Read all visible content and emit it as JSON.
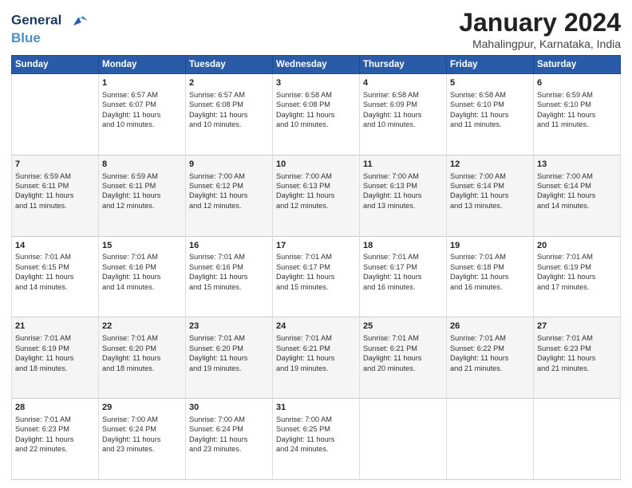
{
  "logo": {
    "line1": "General",
    "line2": "Blue"
  },
  "title": "January 2024",
  "location": "Mahalingpur, Karnataka, India",
  "header_days": [
    "Sunday",
    "Monday",
    "Tuesday",
    "Wednesday",
    "Thursday",
    "Friday",
    "Saturday"
  ],
  "weeks": [
    [
      {
        "day": "",
        "info": ""
      },
      {
        "day": "1",
        "info": "Sunrise: 6:57 AM\nSunset: 6:07 PM\nDaylight: 11 hours\nand 10 minutes."
      },
      {
        "day": "2",
        "info": "Sunrise: 6:57 AM\nSunset: 6:08 PM\nDaylight: 11 hours\nand 10 minutes."
      },
      {
        "day": "3",
        "info": "Sunrise: 6:58 AM\nSunset: 6:08 PM\nDaylight: 11 hours\nand 10 minutes."
      },
      {
        "day": "4",
        "info": "Sunrise: 6:58 AM\nSunset: 6:09 PM\nDaylight: 11 hours\nand 10 minutes."
      },
      {
        "day": "5",
        "info": "Sunrise: 6:58 AM\nSunset: 6:10 PM\nDaylight: 11 hours\nand 11 minutes."
      },
      {
        "day": "6",
        "info": "Sunrise: 6:59 AM\nSunset: 6:10 PM\nDaylight: 11 hours\nand 11 minutes."
      }
    ],
    [
      {
        "day": "7",
        "info": "Sunrise: 6:59 AM\nSunset: 6:11 PM\nDaylight: 11 hours\nand 11 minutes."
      },
      {
        "day": "8",
        "info": "Sunrise: 6:59 AM\nSunset: 6:11 PM\nDaylight: 11 hours\nand 12 minutes."
      },
      {
        "day": "9",
        "info": "Sunrise: 7:00 AM\nSunset: 6:12 PM\nDaylight: 11 hours\nand 12 minutes."
      },
      {
        "day": "10",
        "info": "Sunrise: 7:00 AM\nSunset: 6:13 PM\nDaylight: 11 hours\nand 12 minutes."
      },
      {
        "day": "11",
        "info": "Sunrise: 7:00 AM\nSunset: 6:13 PM\nDaylight: 11 hours\nand 13 minutes."
      },
      {
        "day": "12",
        "info": "Sunrise: 7:00 AM\nSunset: 6:14 PM\nDaylight: 11 hours\nand 13 minutes."
      },
      {
        "day": "13",
        "info": "Sunrise: 7:00 AM\nSunset: 6:14 PM\nDaylight: 11 hours\nand 14 minutes."
      }
    ],
    [
      {
        "day": "14",
        "info": "Sunrise: 7:01 AM\nSunset: 6:15 PM\nDaylight: 11 hours\nand 14 minutes."
      },
      {
        "day": "15",
        "info": "Sunrise: 7:01 AM\nSunset: 6:16 PM\nDaylight: 11 hours\nand 14 minutes."
      },
      {
        "day": "16",
        "info": "Sunrise: 7:01 AM\nSunset: 6:16 PM\nDaylight: 11 hours\nand 15 minutes."
      },
      {
        "day": "17",
        "info": "Sunrise: 7:01 AM\nSunset: 6:17 PM\nDaylight: 11 hours\nand 15 minutes."
      },
      {
        "day": "18",
        "info": "Sunrise: 7:01 AM\nSunset: 6:17 PM\nDaylight: 11 hours\nand 16 minutes."
      },
      {
        "day": "19",
        "info": "Sunrise: 7:01 AM\nSunset: 6:18 PM\nDaylight: 11 hours\nand 16 minutes."
      },
      {
        "day": "20",
        "info": "Sunrise: 7:01 AM\nSunset: 6:19 PM\nDaylight: 11 hours\nand 17 minutes."
      }
    ],
    [
      {
        "day": "21",
        "info": "Sunrise: 7:01 AM\nSunset: 6:19 PM\nDaylight: 11 hours\nand 18 minutes."
      },
      {
        "day": "22",
        "info": "Sunrise: 7:01 AM\nSunset: 6:20 PM\nDaylight: 11 hours\nand 18 minutes."
      },
      {
        "day": "23",
        "info": "Sunrise: 7:01 AM\nSunset: 6:20 PM\nDaylight: 11 hours\nand 19 minutes."
      },
      {
        "day": "24",
        "info": "Sunrise: 7:01 AM\nSunset: 6:21 PM\nDaylight: 11 hours\nand 19 minutes."
      },
      {
        "day": "25",
        "info": "Sunrise: 7:01 AM\nSunset: 6:21 PM\nDaylight: 11 hours\nand 20 minutes."
      },
      {
        "day": "26",
        "info": "Sunrise: 7:01 AM\nSunset: 6:22 PM\nDaylight: 11 hours\nand 21 minutes."
      },
      {
        "day": "27",
        "info": "Sunrise: 7:01 AM\nSunset: 6:23 PM\nDaylight: 11 hours\nand 21 minutes."
      }
    ],
    [
      {
        "day": "28",
        "info": "Sunrise: 7:01 AM\nSunset: 6:23 PM\nDaylight: 11 hours\nand 22 minutes."
      },
      {
        "day": "29",
        "info": "Sunrise: 7:00 AM\nSunset: 6:24 PM\nDaylight: 11 hours\nand 23 minutes."
      },
      {
        "day": "30",
        "info": "Sunrise: 7:00 AM\nSunset: 6:24 PM\nDaylight: 11 hours\nand 23 minutes."
      },
      {
        "day": "31",
        "info": "Sunrise: 7:00 AM\nSunset: 6:25 PM\nDaylight: 11 hours\nand 24 minutes."
      },
      {
        "day": "",
        "info": ""
      },
      {
        "day": "",
        "info": ""
      },
      {
        "day": "",
        "info": ""
      }
    ]
  ]
}
